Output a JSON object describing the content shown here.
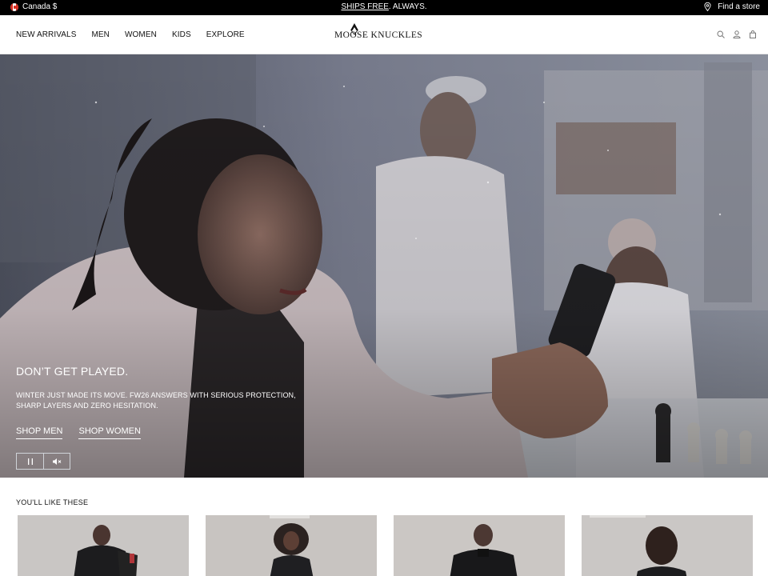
{
  "topbar": {
    "region": "Canada $",
    "promo_link": "SHIPS FREE",
    "promo_rest": ". ALWAYS.",
    "store_label": "Find a store"
  },
  "header": {
    "logo": "MOOSE KNUCKLES",
    "nav": [
      "NEW ARRIVALS",
      "MEN",
      "WOMEN",
      "KIDS",
      "EXPLORE"
    ],
    "icons": [
      "search-icon",
      "account-icon",
      "cart-icon"
    ]
  },
  "hero": {
    "title": "DON’T GET PLAYED.",
    "subtitle": "WINTER JUST MADE ITS MOVE. FW26 ANSWERS WITH SERIOUS PROTECTION, SHARP LAYERS AND ZERO HESITATION.",
    "ctas": [
      "SHOP MEN",
      "SHOP WOMEN"
    ],
    "controls": [
      "pause-icon",
      "mute-icon"
    ]
  },
  "recommendations": {
    "title": "YOU'LL LIKE THESE"
  },
  "colors": {
    "topbar_bg": "#000000",
    "text": "#111111",
    "hero_overlay_text": "#ffffff"
  }
}
